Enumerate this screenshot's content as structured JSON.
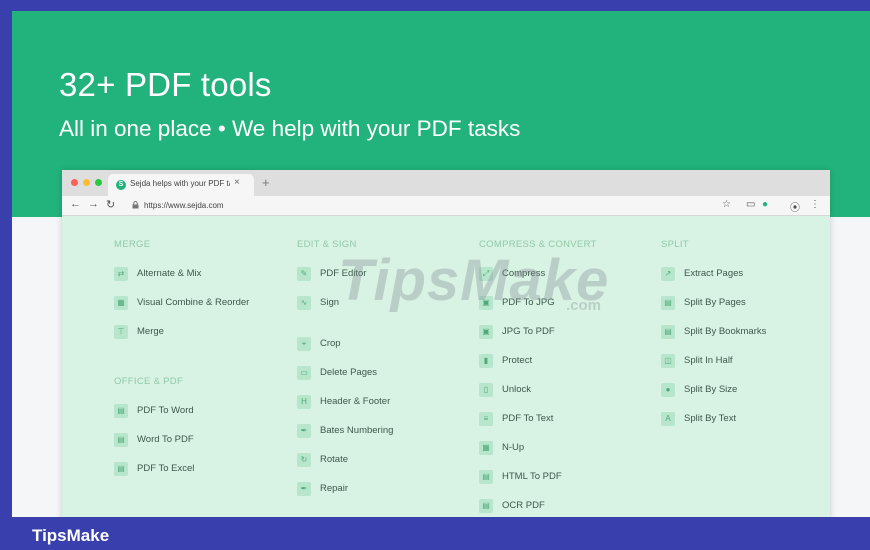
{
  "hero": {
    "title": "32+ PDF tools",
    "subtitle": "All in one place • We help with your PDF tasks"
  },
  "browser": {
    "tab_title": "Sejda helps with your PDF tas",
    "tab_close": "×",
    "new_tab": "+",
    "favicon": "S",
    "url": "https://www.sejda.com",
    "window_dot_colors": [
      "#ff5f57",
      "#febc2e",
      "#28c840"
    ]
  },
  "colors": {
    "hero_bg": "#22b37c",
    "frame": "#3a3fae",
    "browser_bg": "#d8f2e4",
    "section_head": "#8fcaa8"
  },
  "watermark": {
    "text": "TipsMake",
    "suffix": ".com"
  },
  "columns": {
    "merge": {
      "heading": "MERGE",
      "items": [
        {
          "label": "Alternate & Mix",
          "icon": "shuffle-icon"
        },
        {
          "label": "Visual Combine & Reorder",
          "icon": "grid-icon"
        },
        {
          "label": "Merge",
          "icon": "merge-icon"
        }
      ]
    },
    "office": {
      "heading": "OFFICE & PDF",
      "items": [
        {
          "label": "PDF To Word",
          "icon": "doc-icon"
        },
        {
          "label": "Word To PDF",
          "icon": "doc-icon"
        },
        {
          "label": "PDF To Excel",
          "icon": "doc-icon"
        }
      ]
    },
    "edit": {
      "heading": "EDIT & SIGN",
      "items": [
        {
          "label": "PDF Editor",
          "icon": "pencil-icon"
        },
        {
          "label": "Sign",
          "icon": "signature-icon"
        },
        {
          "label": "Crop",
          "icon": "crop-icon"
        },
        {
          "label": "Delete Pages",
          "icon": "trash-icon"
        },
        {
          "label": "Header & Footer",
          "icon": "header-icon"
        },
        {
          "label": "Bates Numbering",
          "icon": "stamp-icon"
        },
        {
          "label": "Rotate",
          "icon": "rotate-icon"
        },
        {
          "label": "Repair",
          "icon": "wrench-icon"
        }
      ]
    },
    "compress": {
      "heading": "COMPRESS & CONVERT",
      "items": [
        {
          "label": "Compress",
          "icon": "compress-icon"
        },
        {
          "label": "PDF To JPG",
          "icon": "image-icon"
        },
        {
          "label": "JPG To PDF",
          "icon": "image-icon"
        },
        {
          "label": "Protect",
          "icon": "lock-icon"
        },
        {
          "label": "Unlock",
          "icon": "unlock-icon"
        },
        {
          "label": "PDF To Text",
          "icon": "text-icon"
        },
        {
          "label": "N-Up",
          "icon": "grid-icon"
        },
        {
          "label": "HTML To PDF",
          "icon": "doc-icon"
        },
        {
          "label": "OCR PDF",
          "icon": "ocr-icon"
        }
      ]
    },
    "split": {
      "heading": "SPLIT",
      "items": [
        {
          "label": "Extract Pages",
          "icon": "extract-icon"
        },
        {
          "label": "Split By Pages",
          "icon": "split-icon"
        },
        {
          "label": "Split By Bookmarks",
          "icon": "bookmark-icon"
        },
        {
          "label": "Split In Half",
          "icon": "half-icon"
        },
        {
          "label": "Split By Size",
          "icon": "size-icon"
        },
        {
          "label": "Split By Text",
          "icon": "text-icon"
        }
      ]
    }
  },
  "footer": {
    "brand": "TipsMake"
  }
}
